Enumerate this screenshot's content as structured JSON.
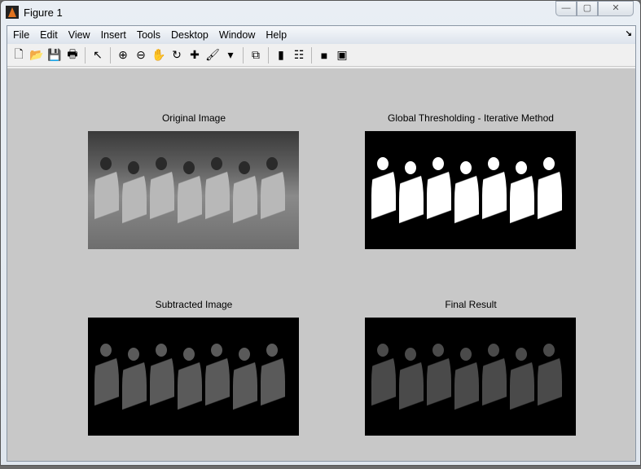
{
  "window": {
    "title": "Figure 1",
    "minimize": "—",
    "maximize": "▢",
    "close": "✕"
  },
  "menu": [
    "File",
    "Edit",
    "View",
    "Insert",
    "Tools",
    "Desktop",
    "Window",
    "Help"
  ],
  "toolbar": [
    {
      "name": "new-figure-icon",
      "glyph": "🗋"
    },
    {
      "name": "open-icon",
      "glyph": "📂"
    },
    {
      "name": "save-icon",
      "glyph": "💾"
    },
    {
      "name": "print-icon",
      "glyph": "🖶"
    },
    {
      "sep": true
    },
    {
      "name": "pointer-icon",
      "glyph": "↖"
    },
    {
      "sep": true
    },
    {
      "name": "zoom-in-icon",
      "glyph": "⊕"
    },
    {
      "name": "zoom-out-icon",
      "glyph": "⊖"
    },
    {
      "name": "pan-icon",
      "glyph": "✋"
    },
    {
      "name": "rotate-icon",
      "glyph": "↻"
    },
    {
      "name": "data-cursor-icon",
      "glyph": "✚"
    },
    {
      "name": "brush-icon",
      "glyph": "🖌"
    },
    {
      "name": "brush-dropdown-icon",
      "glyph": "▾"
    },
    {
      "sep": true
    },
    {
      "name": "link-plot-icon",
      "glyph": "⧉"
    },
    {
      "sep": true
    },
    {
      "name": "colorbar-icon",
      "glyph": "▮"
    },
    {
      "name": "legend-icon",
      "glyph": "☷"
    },
    {
      "sep": true
    },
    {
      "name": "hide-plot-tools-icon",
      "glyph": "■"
    },
    {
      "name": "show-plot-tools-icon",
      "glyph": "▣"
    }
  ],
  "axes": [
    {
      "title": "Original Image",
      "kind": "orig"
    },
    {
      "title": "Global Thresholding - Iterative Method",
      "kind": "thr"
    },
    {
      "title": "Subtracted Image",
      "kind": "sub"
    },
    {
      "title": "Final Result",
      "kind": "fin"
    }
  ],
  "colors": {
    "figure_bg": "#c8c8c8"
  }
}
